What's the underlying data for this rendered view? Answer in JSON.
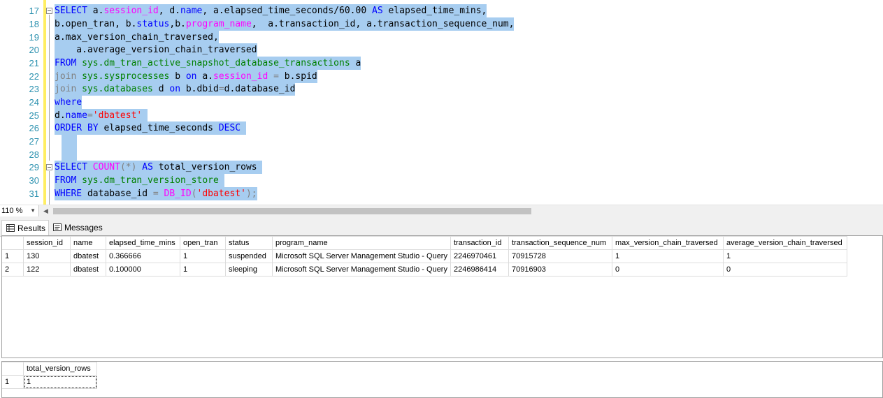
{
  "editor": {
    "line_numbers": [
      "17",
      "18",
      "19",
      "20",
      "21",
      "22",
      "23",
      "24",
      "25",
      "26",
      "27",
      "28",
      "29",
      "30",
      "31"
    ],
    "lines": [
      {
        "ln": "17",
        "segments": [
          {
            "t": "SELECT",
            "c": "kw"
          },
          {
            "t": " a.",
            "c": ""
          },
          {
            "t": "session_id",
            "c": "fn"
          },
          {
            "t": ", d.",
            "c": ""
          },
          {
            "t": "name",
            "c": "kw"
          },
          {
            "t": ", a.elapsed_time_seconds/60.00 ",
            "c": ""
          },
          {
            "t": "AS",
            "c": "kw"
          },
          {
            "t": " elapsed_time_mins,",
            "c": ""
          }
        ]
      },
      {
        "ln": "18",
        "segments": [
          {
            "t": "b.open_tran, b.",
            "c": ""
          },
          {
            "t": "status",
            "c": "kw"
          },
          {
            "t": ",b.",
            "c": ""
          },
          {
            "t": "program_name",
            "c": "fn"
          },
          {
            "t": ",  a.transaction_id, a.transaction_sequence_num,",
            "c": ""
          }
        ]
      },
      {
        "ln": "19",
        "segments": [
          {
            "t": "a.max_version_chain_traversed,",
            "c": ""
          }
        ]
      },
      {
        "ln": "20",
        "segments": [
          {
            "t": "    a.average_version_chain_traversed",
            "c": ""
          }
        ]
      },
      {
        "ln": "21",
        "segments": [
          {
            "t": "FROM",
            "c": "kw"
          },
          {
            "t": " ",
            "c": ""
          },
          {
            "t": "sys.dm_tran_active_snapshot_database_transactions",
            "c": "sys"
          },
          {
            "t": " a",
            "c": ""
          }
        ]
      },
      {
        "ln": "22",
        "segments": [
          {
            "t": "join",
            "c": "gr"
          },
          {
            "t": " ",
            "c": ""
          },
          {
            "t": "sys.sysprocesses",
            "c": "sys"
          },
          {
            "t": " b ",
            "c": ""
          },
          {
            "t": "on",
            "c": "kw"
          },
          {
            "t": " a.",
            "c": ""
          },
          {
            "t": "session_id",
            "c": "fn"
          },
          {
            "t": " ",
            "c": ""
          },
          {
            "t": "=",
            "c": "gr"
          },
          {
            "t": " b.spid",
            "c": ""
          }
        ]
      },
      {
        "ln": "23",
        "segments": [
          {
            "t": "join",
            "c": "gr"
          },
          {
            "t": " ",
            "c": ""
          },
          {
            "t": "sys.databases",
            "c": "sys"
          },
          {
            "t": " d ",
            "c": ""
          },
          {
            "t": "on",
            "c": "kw"
          },
          {
            "t": " b.dbid",
            "c": ""
          },
          {
            "t": "=",
            "c": "gr"
          },
          {
            "t": "d.database_id",
            "c": ""
          }
        ]
      },
      {
        "ln": "24",
        "segments": [
          {
            "t": "where",
            "c": "kw"
          }
        ]
      },
      {
        "ln": "25",
        "segments": [
          {
            "t": "d.",
            "c": ""
          },
          {
            "t": "name",
            "c": "kw"
          },
          {
            "t": "=",
            "c": "gr"
          },
          {
            "t": "'dbatest'",
            "c": "str"
          },
          {
            "t": " ",
            "c": ""
          }
        ]
      },
      {
        "ln": "26",
        "segments": [
          {
            "t": "ORDER BY",
            "c": "kw"
          },
          {
            "t": " elapsed_time_seconds ",
            "c": ""
          },
          {
            "t": "DESC",
            "c": "kw"
          },
          {
            "t": " ",
            "c": ""
          }
        ]
      },
      {
        "ln": "27",
        "segments": [
          {
            "t": "  ",
            "c": ""
          }
        ]
      },
      {
        "ln": "28",
        "segments": [
          {
            "t": "",
            "c": ""
          }
        ]
      },
      {
        "ln": "29",
        "segments": [
          {
            "t": "SELECT",
            "c": "kw"
          },
          {
            "t": " ",
            "c": ""
          },
          {
            "t": "COUNT",
            "c": "fn"
          },
          {
            "t": "(*)",
            "c": "gr"
          },
          {
            "t": " ",
            "c": ""
          },
          {
            "t": "AS",
            "c": "kw"
          },
          {
            "t": " total_version_rows ",
            "c": ""
          }
        ]
      },
      {
        "ln": "30",
        "segments": [
          {
            "t": "FROM",
            "c": "kw"
          },
          {
            "t": " ",
            "c": ""
          },
          {
            "t": "sys.dm_tran_version_store",
            "c": "sys"
          },
          {
            "t": " ",
            "c": ""
          }
        ]
      },
      {
        "ln": "31",
        "segments": [
          {
            "t": "WHERE",
            "c": "kw"
          },
          {
            "t": " database_id ",
            "c": ""
          },
          {
            "t": "=",
            "c": "gr"
          },
          {
            "t": " ",
            "c": ""
          },
          {
            "t": "DB_ID",
            "c": "fn"
          },
          {
            "t": "(",
            "c": "gr"
          },
          {
            "t": "'dbatest'",
            "c": "str"
          },
          {
            "t": ");",
            "c": "gr"
          }
        ]
      }
    ]
  },
  "zoom": {
    "value": "110 %"
  },
  "tabs": {
    "results": "Results",
    "messages": "Messages"
  },
  "grid1": {
    "columns": [
      "session_id",
      "name",
      "elapsed_time_mins",
      "open_tran",
      "status",
      "program_name",
      "transaction_id",
      "transaction_sequence_num",
      "max_version_chain_traversed",
      "average_version_chain_traversed"
    ],
    "rows": [
      {
        "n": "1",
        "cells": [
          "130",
          "dbatest",
          "0.366666",
          "1",
          "suspended",
          "Microsoft SQL Server Management Studio - Query",
          "2246970461",
          "70915728",
          "1",
          "1"
        ]
      },
      {
        "n": "2",
        "cells": [
          "122",
          "dbatest",
          "0.100000",
          "1",
          "sleeping",
          "Microsoft SQL Server Management Studio - Query",
          "2246986414",
          "70916903",
          "0",
          "0"
        ]
      }
    ]
  },
  "grid2": {
    "columns": [
      "total_version_rows"
    ],
    "rows": [
      {
        "n": "1",
        "cells": [
          "1"
        ]
      }
    ]
  }
}
